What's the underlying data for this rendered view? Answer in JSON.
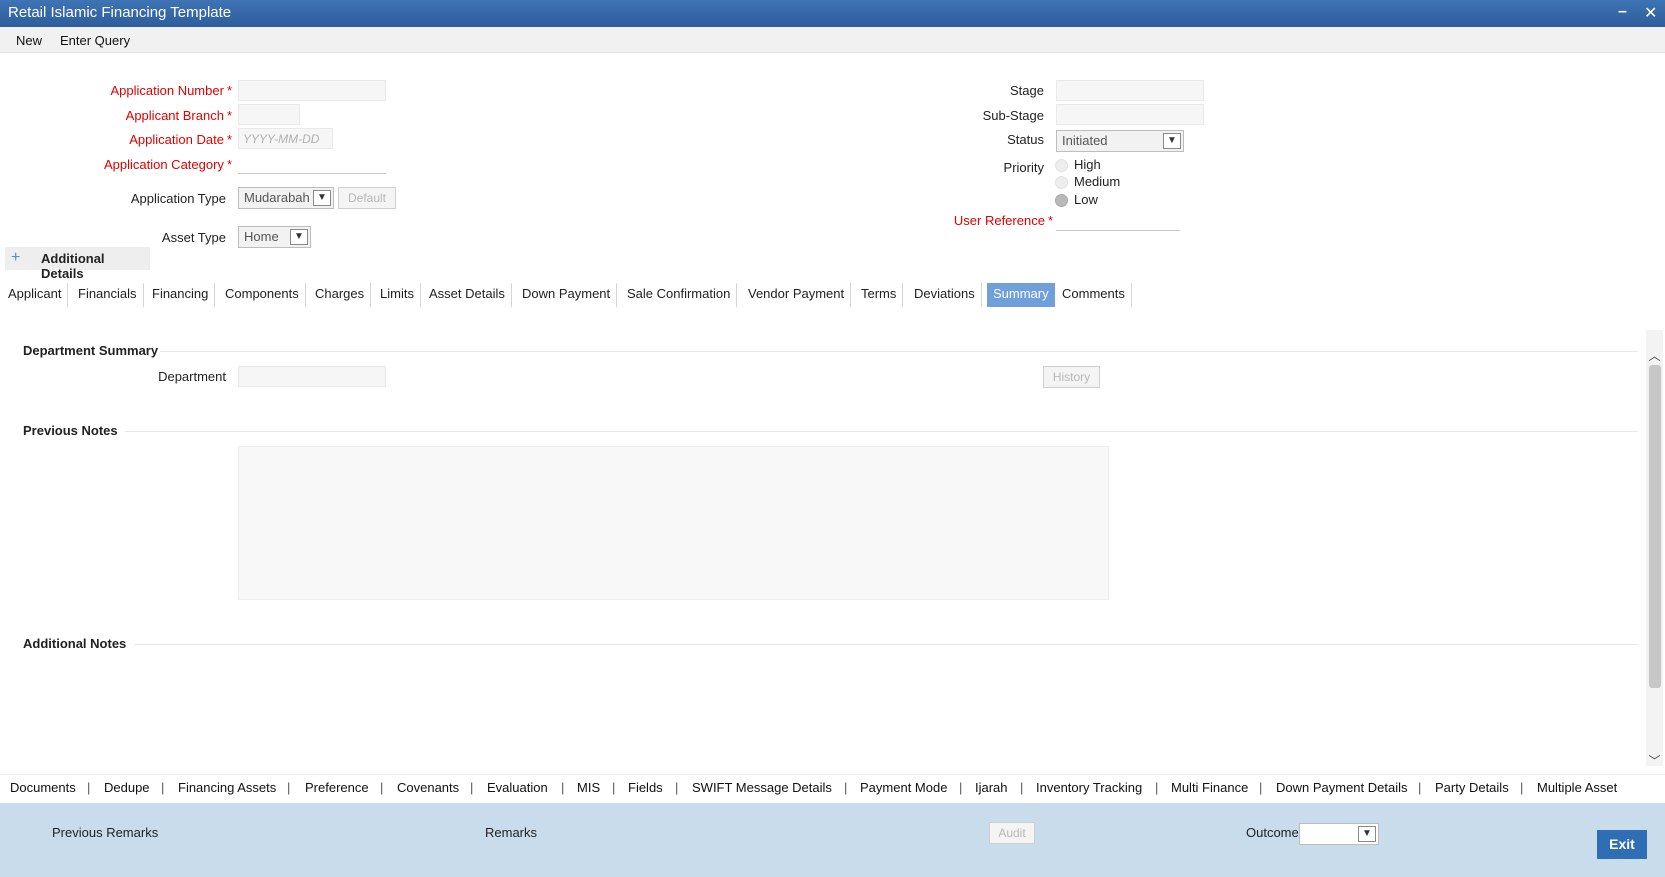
{
  "window": {
    "title": "Retail Islamic Financing Template",
    "minimize_glyph": "–",
    "close_glyph": "✕"
  },
  "menu": {
    "new": "New",
    "enter_query": "Enter Query"
  },
  "form": {
    "application_number_label": "Application Number",
    "applicant_branch_label": "Applicant Branch",
    "application_date_label": "Application Date",
    "application_date_placeholder": "YYYY-MM-DD",
    "application_category_label": "Application Category",
    "application_type_label": "Application Type",
    "application_type_value": "Mudarabah",
    "default_button": "Default",
    "asset_type_label": "Asset Type",
    "asset_type_value": "Home",
    "stage_label": "Stage",
    "sub_stage_label": "Sub-Stage",
    "status_label": "Status",
    "status_value": "Initiated",
    "priority_label": "Priority",
    "priority_options": [
      "High",
      "Medium",
      "Low"
    ],
    "priority_selected": "Low",
    "user_reference_label": "User Reference",
    "required_mark": "*"
  },
  "additional_details": {
    "plus": "+",
    "label": "Additional Details"
  },
  "tabs": [
    "Applicant",
    "Financials",
    "Financing",
    "Components",
    "Charges",
    "Limits",
    "Asset Details",
    "Down Payment",
    "Sale Confirmation",
    "Vendor Payment",
    "Terms",
    "Deviations",
    "Summary",
    "Comments"
  ],
  "active_tab": "Summary",
  "summary": {
    "department_summary_title": "Department Summary",
    "department_label": "Department",
    "history_button": "History",
    "previous_notes_title": "Previous Notes",
    "additional_notes_title": "Additional Notes"
  },
  "bottom_links": [
    "Documents",
    "Dedupe",
    "Financing Assets",
    "Preference",
    "Covenants",
    "Evaluation",
    "MIS",
    "Fields",
    "SWIFT Message Details",
    "Payment Mode",
    "Ijarah",
    "Inventory Tracking",
    "Multi Finance",
    "Down Payment Details",
    "Party Details",
    "Multiple Asset"
  ],
  "bottom_separator": "|",
  "footer": {
    "previous_remarks_label": "Previous Remarks",
    "remarks_label": "Remarks",
    "audit_button": "Audit",
    "outcome_label": "Outcome",
    "exit_button": "Exit"
  },
  "icons": {
    "chevron_down": "chevron-down-icon",
    "plus": "plus-icon",
    "scroll_up": "chevron-up-icon",
    "scroll_down": "chevron-down-icon"
  },
  "colors": {
    "titlebar": "#2f63a6",
    "required": "#e00000",
    "active_tab": "#6fa0d9",
    "footer": "#c9dcec",
    "exit_button": "#2f6eb5"
  }
}
